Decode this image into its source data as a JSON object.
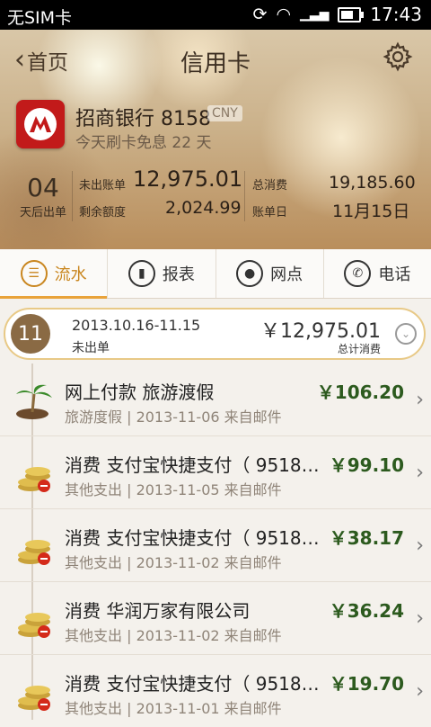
{
  "status_bar": {
    "carrier": "无SIM卡",
    "time": "17:43"
  },
  "header": {
    "back_label": "首页",
    "title": "信用卡"
  },
  "card": {
    "bank_name": "招商银行 8158",
    "currency": "CNY",
    "free_days_text": "今天刷卡免息 22 天",
    "days_num": "04",
    "days_label": "天后出单",
    "unbilled_label": "未出账单",
    "unbilled_value": "12,975.01",
    "remaining_label": "剩余额度",
    "remaining_value": "2,024.99",
    "total_spend_label": "总消费",
    "total_spend_value": "19,185.60",
    "bill_day_label": "账单日",
    "bill_day_value": "11月15日"
  },
  "tabs": [
    {
      "label": "流水",
      "icon": "list-icon"
    },
    {
      "label": "报表",
      "icon": "bar-chart-icon"
    },
    {
      "label": "网点",
      "icon": "location-pin-icon"
    },
    {
      "label": "电话",
      "icon": "phone-icon"
    }
  ],
  "bill": {
    "month": "11",
    "period": "2013.10.16-11.15",
    "status": "未出单",
    "total": "￥12,975.01",
    "total_label": "总计消费"
  },
  "transactions": [
    {
      "title": "网上付款 旅游渡假",
      "subtitle": "旅游度假 | 2013-11-06 来自邮件",
      "amount": "￥106.20",
      "icon": "palm-tree-icon"
    },
    {
      "title": "消费 支付宝快捷支付（ 9518…",
      "subtitle": "其他支出 | 2013-11-05 来自邮件",
      "amount": "￥99.10",
      "icon": "coins-icon"
    },
    {
      "title": "消费 支付宝快捷支付（ 9518…",
      "subtitle": "其他支出 | 2013-11-02 来自邮件",
      "amount": "￥38.17",
      "icon": "coins-icon"
    },
    {
      "title": "消费 华润万家有限公司",
      "subtitle": "其他支出 | 2013-11-02 来自邮件",
      "amount": "￥36.24",
      "icon": "coins-icon"
    },
    {
      "title": "消费 支付宝快捷支付（ 9518…",
      "subtitle": "其他支出 | 2013-11-01 来自邮件",
      "amount": "￥19.70",
      "icon": "coins-icon"
    }
  ],
  "colors": {
    "accent": "#e9a33a",
    "amount": "#2c5a1e",
    "brand_red": "#c21a1a"
  }
}
